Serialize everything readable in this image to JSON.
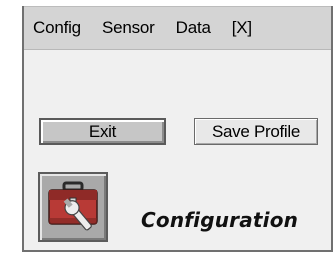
{
  "menu": {
    "items": [
      "Config",
      "Sensor",
      "Data",
      "[X]"
    ]
  },
  "buttons": {
    "exit_label": "Exit",
    "save_label": "Save Profile"
  },
  "section": {
    "title": "Configuration",
    "icon": "toolbox-wrench-icon"
  },
  "colors": {
    "menubar": "#d4d4d4",
    "panel": "#f0f0f0",
    "toolbox_red": "#b83a36"
  }
}
